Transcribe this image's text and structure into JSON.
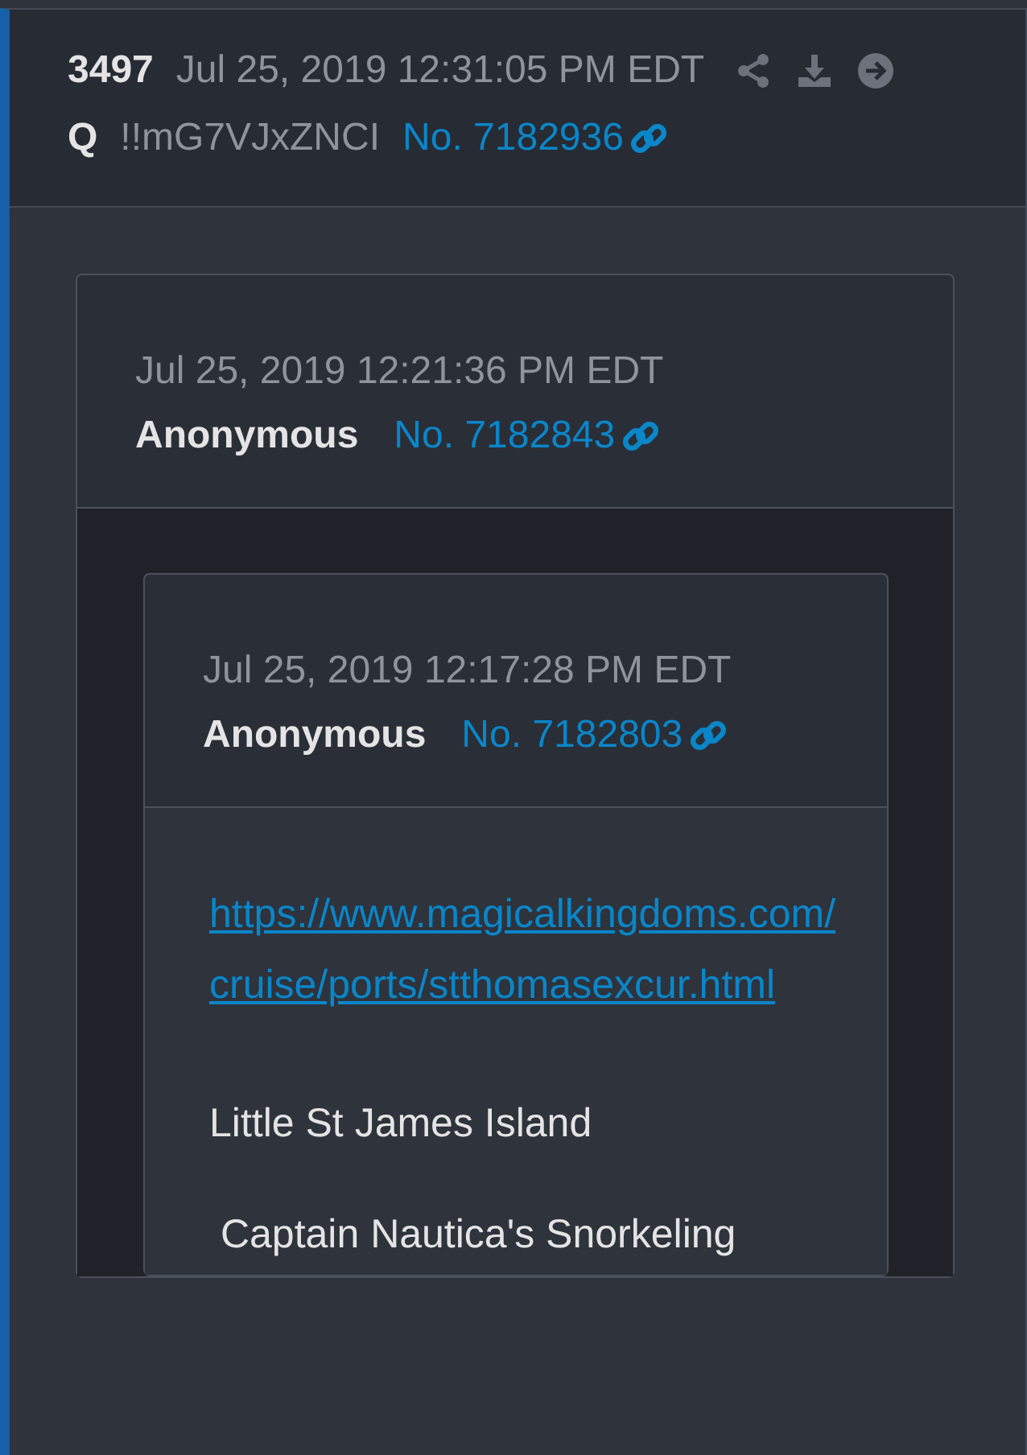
{
  "post": {
    "number": "3497",
    "timestamp": "Jul 25, 2019 12:31:05 PM EDT",
    "author": "Q",
    "tripcode": "!!mG7VJxZNCI",
    "post_link": "No. 7182936",
    "quote": {
      "timestamp": "Jul 25, 2019 12:21:36 PM EDT",
      "author": "Anonymous",
      "post_link": "No. 7182843",
      "quote": {
        "timestamp": "Jul 25, 2019 12:17:28 PM EDT",
        "author": "Anonymous",
        "post_link": "No. 7182803",
        "body": [
          {
            "kind": "link",
            "text": "https://www.magicalkingdoms.com/cruise/ports/stthomasexcur.html"
          },
          {
            "kind": "text",
            "text": "Little St James Island"
          },
          {
            "kind": "text",
            "text": " Captain Nautica's Snorkeling"
          }
        ]
      }
    }
  }
}
